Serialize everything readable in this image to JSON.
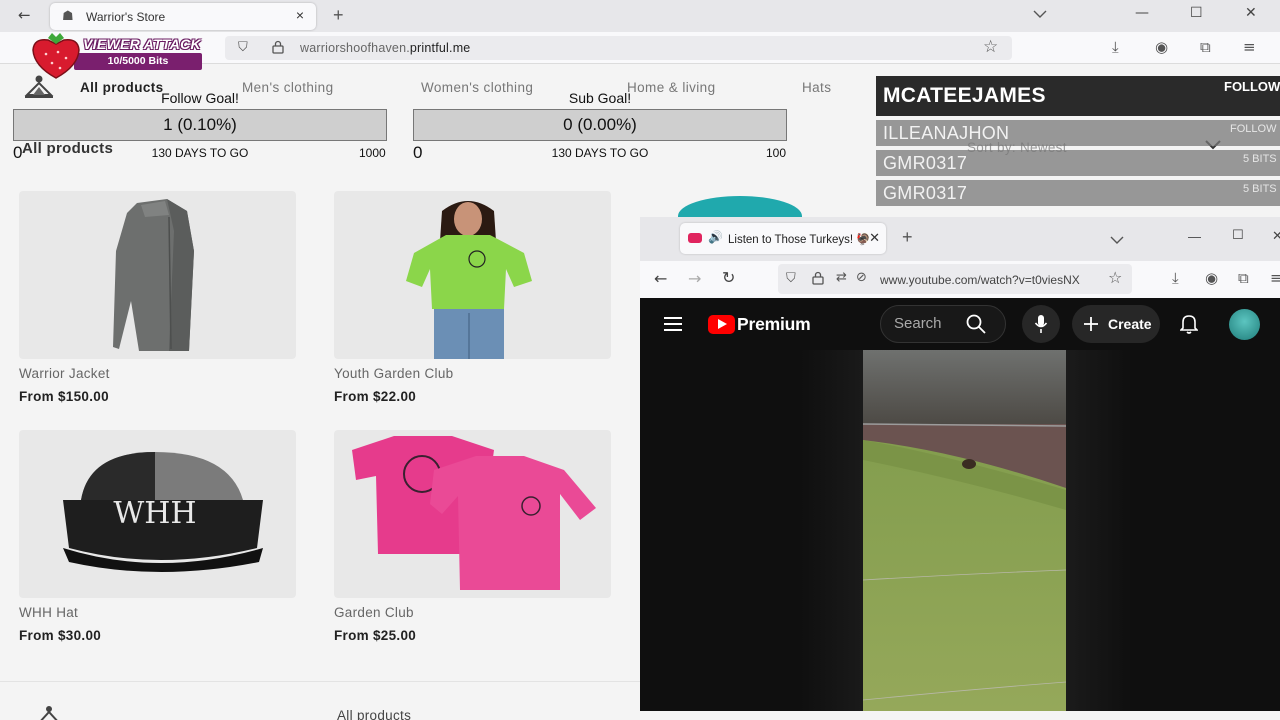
{
  "browser": {
    "tab_title": "Warrior's Store",
    "tab_close": "×",
    "new_tab": "+",
    "url_domain": "warriorshoofhaven.",
    "url_host": "printful.me"
  },
  "store": {
    "nav": [
      "All products",
      "Men's clothing",
      "Women's clothing",
      "Home & living",
      "Hats"
    ],
    "section_title": "All products",
    "products": [
      {
        "name": "Warrior Jacket",
        "price": "From $150.00"
      },
      {
        "name": "Youth Garden Club",
        "price": "From $22.00"
      },
      {
        "name": "WHH Hat",
        "price": "From $30.00"
      },
      {
        "name": "Garden Club",
        "price": "From $25.00"
      }
    ],
    "hat_text": "WHH",
    "footer_link": "All products",
    "sort_label": "Sort by: Newest"
  },
  "overlay": {
    "viewer_attack": {
      "title": "VIEWER ATTACK",
      "count": "10/5000 Bits",
      "progress": 0.002
    },
    "follow_goal": {
      "label": "Follow Goal!",
      "value": "1 (0.10%)",
      "min": "0",
      "days": "130 DAYS TO GO",
      "max": "1000",
      "progress": 0.001
    },
    "sub_goal": {
      "label": "Sub Goal!",
      "value": "0 (0.00%)",
      "min": "0",
      "days": "130 DAYS TO GO",
      "max": "100",
      "progress": 0.0
    },
    "events": [
      {
        "name": "MCATEEJAMES",
        "tag": "FOLLOW"
      },
      {
        "name": "ILLEANAJHON",
        "tag": "FOLLOW"
      },
      {
        "name": "GMR0317",
        "tag": "5 BITS"
      },
      {
        "name": "GMR0317",
        "tag": "5 BITS"
      }
    ]
  },
  "youtube": {
    "tab_title": "Listen to Those Turkeys! 🦃",
    "url": "www.youtube.com/watch?v=t0viesNX",
    "brand": "Premium",
    "search_placeholder": "Search",
    "create_label": "Create"
  },
  "colors": {
    "yt_red": "#ff0000",
    "goal_bar": "#cfcfcf",
    "va_purple": "#7a1f6e",
    "teal": "#20a9ad"
  }
}
